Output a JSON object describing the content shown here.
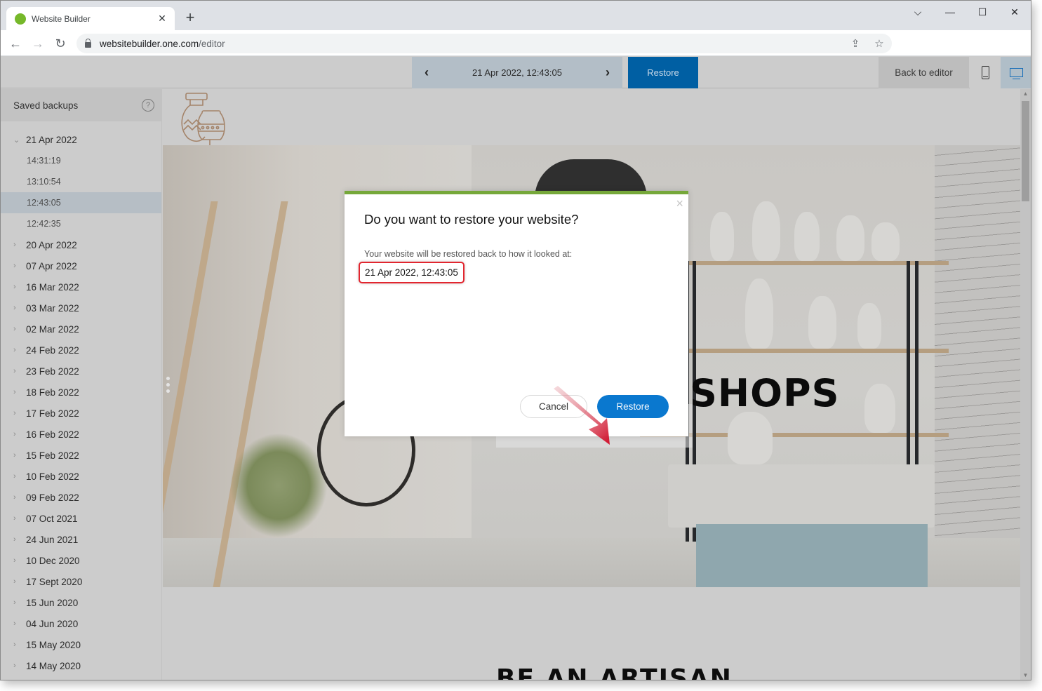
{
  "browser": {
    "tab_title": "Website Builder",
    "tab_close": "✕",
    "new_tab": "+",
    "url_host": "websitebuilder.one.com",
    "url_path": "/editor",
    "window_controls": {
      "dropdown": "⌵",
      "minimize": "—",
      "maximize": "☐",
      "close": "✕"
    },
    "nav": {
      "back": "←",
      "forward": "→",
      "reload": "↻"
    },
    "icons": {
      "share": "⇪",
      "bookmark": "☆"
    }
  },
  "editor_bar": {
    "prev_label": "‹",
    "next_label": "›",
    "current_version": "21 Apr 2022, 12:43:05",
    "restore_label": "Restore",
    "back_to_editor_label": "Back to editor",
    "active_device": "desktop"
  },
  "sidebar": {
    "title": "Saved backups",
    "help_label": "?",
    "expanded_day": {
      "label": "21 Apr 2022",
      "chevron": "⌄",
      "times": [
        "14:31:19",
        "13:10:54",
        "12:43:05",
        "12:42:35"
      ],
      "selected_time": "12:43:05"
    },
    "collapsed_days": [
      "20 Apr 2022",
      "07 Apr 2022",
      "16 Mar 2022",
      "03 Mar 2022",
      "02 Mar 2022",
      "24 Feb 2022",
      "23 Feb 2022",
      "18 Feb 2022",
      "17 Feb 2022",
      "16 Feb 2022",
      "15 Feb 2022",
      "10 Feb 2022",
      "09 Feb 2022",
      "07 Oct 2021",
      "24 Jun 2021",
      "10 Dec 2020",
      "17 Sept 2020",
      "15 Jun 2020",
      "04 Jun 2020",
      "15 May 2020",
      "14 May 2020"
    ],
    "collapsed_chevron": "›"
  },
  "preview": {
    "hero_title": "SHOPS",
    "section_title": "BE AN ARTISAN"
  },
  "scrollbar": {
    "up": "▲",
    "down": "▼",
    "position_fraction": 0.0
  },
  "modal": {
    "title": "Do you want to restore your website?",
    "body": "Your website will be restored back to how it looked at:",
    "date": "21 Apr 2022, 12:43:05",
    "close_label": "×",
    "cancel_label": "Cancel",
    "restore_label": "Restore",
    "accent_color": "#76a83a",
    "highlight_color": "#e2262f",
    "primary_color": "#0a78cf"
  }
}
